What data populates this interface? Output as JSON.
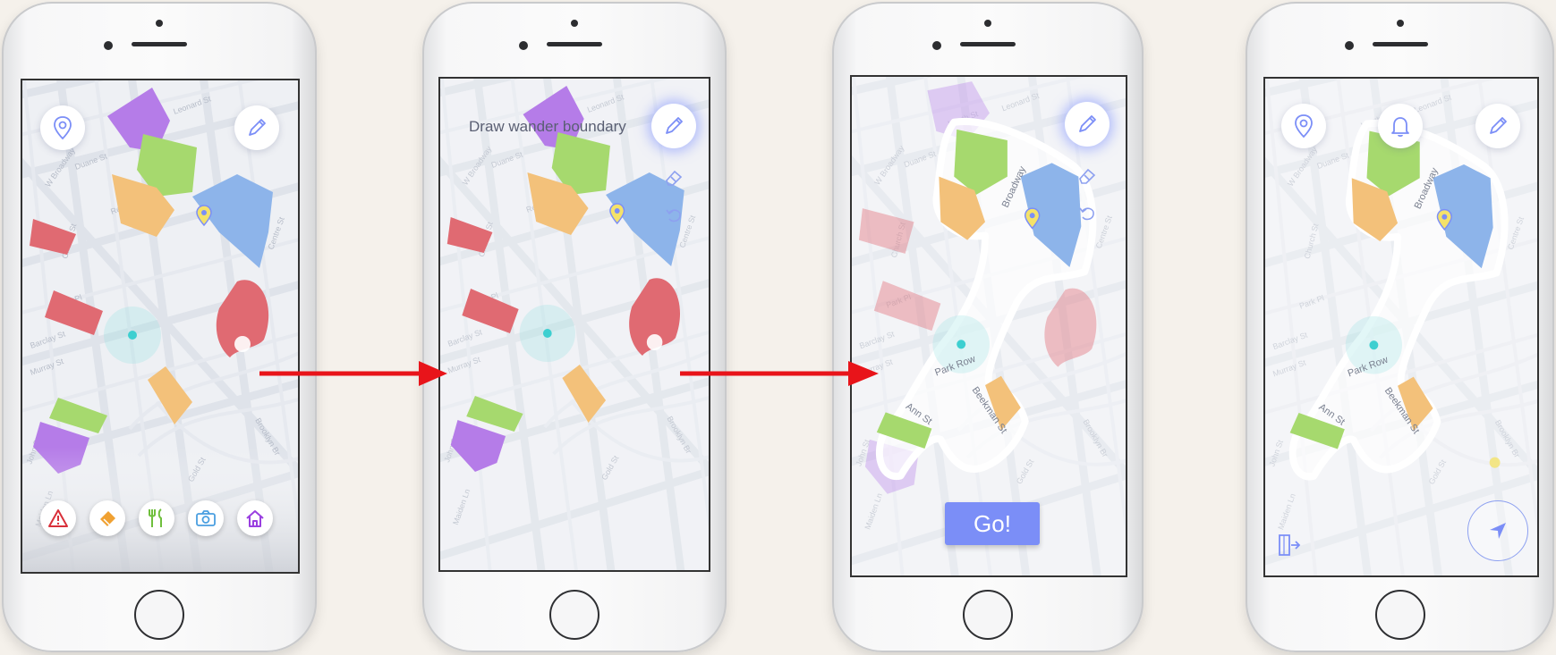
{
  "screens": {
    "s1": {
      "toolbar": {
        "items": [
          {
            "icon": "warning-icon",
            "color": "#d9303a"
          },
          {
            "icon": "ticket-icon",
            "color": "#f0a132"
          },
          {
            "icon": "fork-knife-icon",
            "color": "#6fbf3d"
          },
          {
            "icon": "camera-icon",
            "color": "#4a9fe0"
          },
          {
            "icon": "home-icon",
            "color": "#9a3fe0"
          }
        ]
      },
      "buttons": {
        "location": "location-pin-icon",
        "edit": "pencil-icon"
      }
    },
    "s2": {
      "hint": "Draw wander boundary",
      "buttons": {
        "edit": "pencil-icon",
        "eraser": "eraser-icon",
        "undo": "undo-icon"
      }
    },
    "s3": {
      "go_label": "Go!",
      "street_labels": [
        "Park Row",
        "Ann St",
        "Beekman St",
        "Broadway"
      ],
      "buttons": {
        "edit": "pencil-icon",
        "eraser": "eraser-icon",
        "undo": "undo-icon"
      }
    },
    "s4": {
      "buttons": {
        "location": "location-pin-icon",
        "alert": "bell-icon",
        "edit": "pencil-icon",
        "exit": "exit-icon",
        "navigate": "navigation-arrow-icon"
      },
      "street_labels": [
        "Park Row",
        "Ann St",
        "Beekman St",
        "Broadway"
      ]
    }
  },
  "colors": {
    "purple": "#b57ce8",
    "green": "#a6d96e",
    "orange": "#f3c17a",
    "blue": "#8db4ea",
    "red": "#e06a72",
    "accent": "#7b8ef7",
    "flow_arrow": "#e8141a"
  },
  "map_streets": [
    "Leonard St",
    "Worth St",
    "Duane St",
    "W Broadway",
    "Church St",
    "Reade St",
    "Chambers St",
    "Barclay St",
    "Park Pl",
    "Murray St",
    "Park Row",
    "Beekman St",
    "Spruce St",
    "Ann St",
    "John St",
    "Gold St",
    "Maiden Ln",
    "Broadway",
    "Centre St",
    "Frankfort St",
    "Dutch St"
  ]
}
